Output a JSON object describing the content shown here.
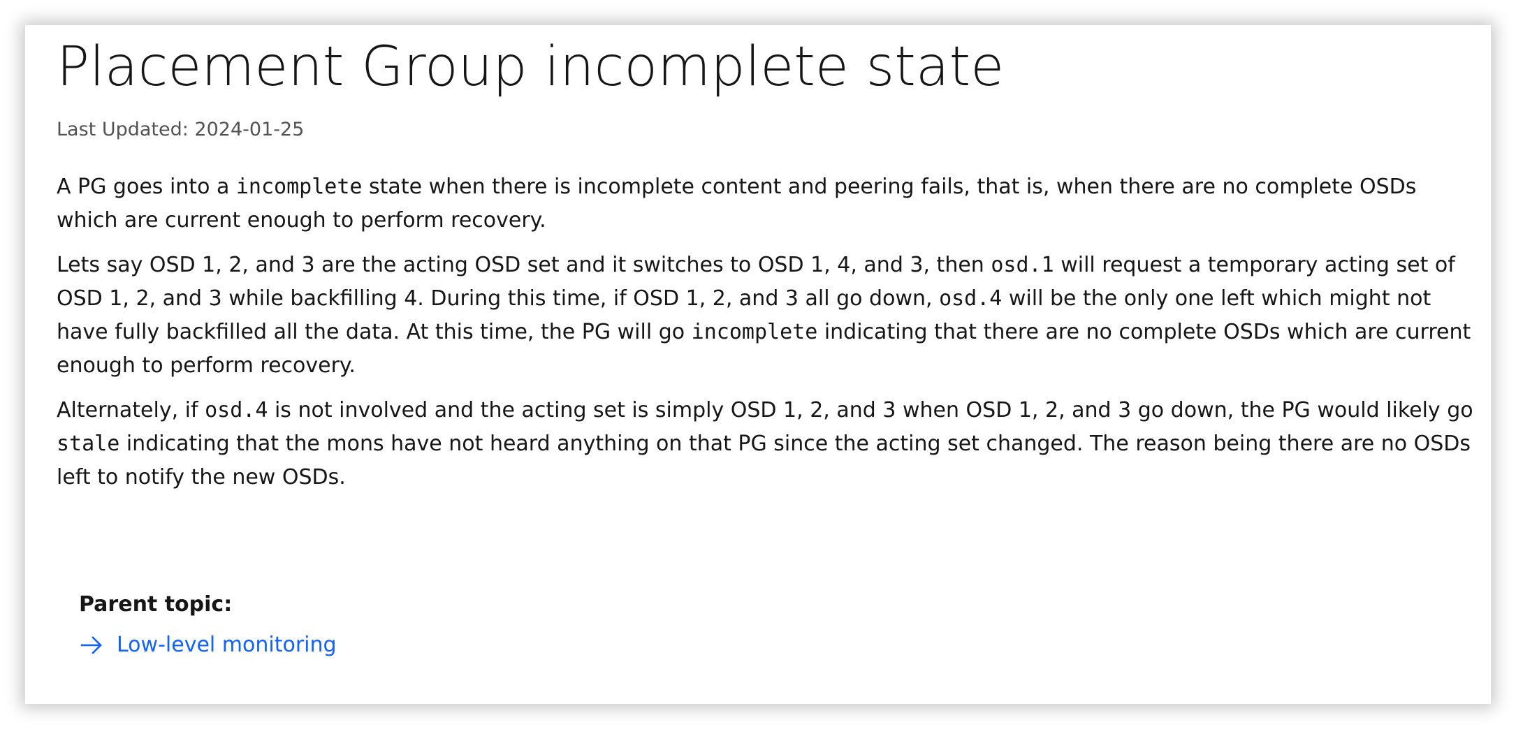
{
  "title": "Placement Group incomplete state",
  "last_updated": "Last Updated: 2024-01-25",
  "paragraphs": {
    "p1": {
      "t1": "A PG goes into a ",
      "c1": "incomplete",
      "t2": " state when there is incomplete content and peering fails, that is, when there are no complete OSDs which are current enough to perform recovery."
    },
    "p2": {
      "t1": "Lets say OSD 1, 2, and 3 are the acting OSD set and it switches to OSD 1, 4, and 3, then ",
      "c1": "osd.1",
      "t2": " will request a temporary acting set of OSD 1, 2, and 3 while backfilling 4. During this time, if OSD 1, 2, and 3 all go down, ",
      "c2": "osd.4",
      "t3": " will be the only one left which might not have fully backfilled all the data. At this time, the PG will go ",
      "c3": "incomplete",
      "t4": " indicating that there are no complete OSDs which are current enough to perform recovery."
    },
    "p3": {
      "t1": "Alternately, if ",
      "c1": "osd.4",
      "t2": " is not involved and the acting set is simply OSD 1, 2, and 3 when OSD 1, 2, and 3 go down, the PG would likely go ",
      "c2": "stale",
      "t3": " indicating that the mons have not heard anything on that PG since the acting set changed. The reason being there are no OSDs left to notify the new OSDs."
    }
  },
  "parent_topic": {
    "label": "Parent topic:",
    "link_text": "Low-level monitoring",
    "icon": "arrow-right-icon"
  },
  "colors": {
    "link": "#0f62fe",
    "text": "#161616",
    "muted": "#525252"
  }
}
